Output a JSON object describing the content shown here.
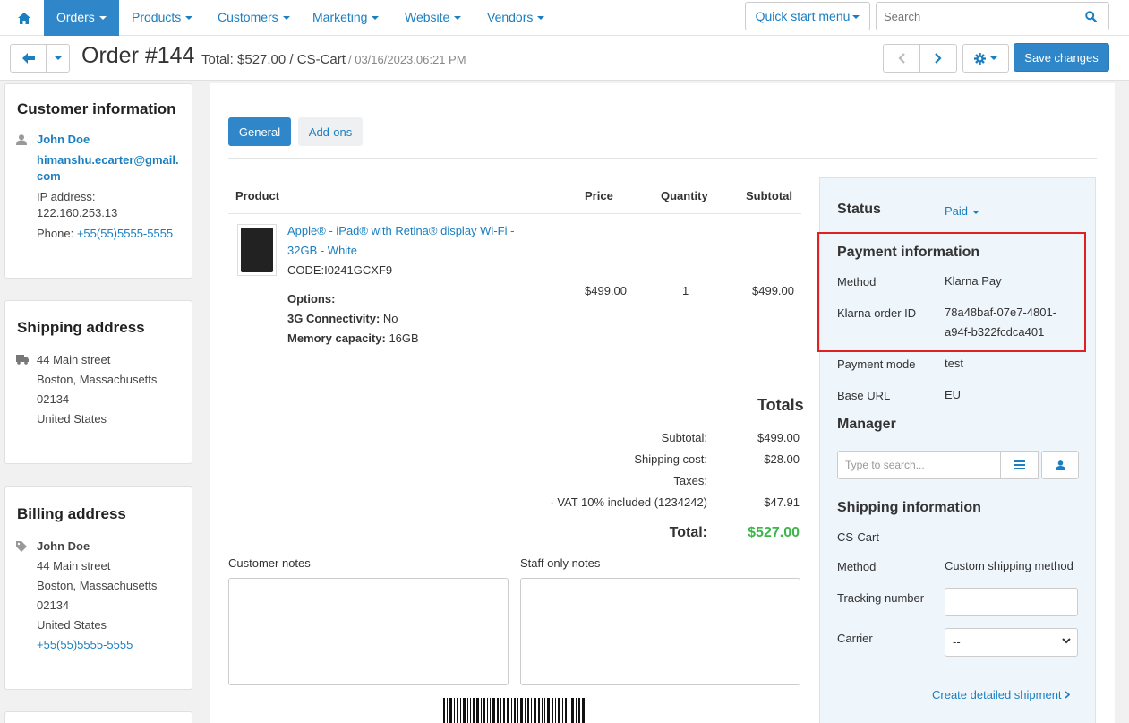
{
  "nav": {
    "items": [
      {
        "label": "Orders",
        "active": true
      },
      {
        "label": "Products"
      },
      {
        "label": "Customers"
      },
      {
        "label": "Marketing"
      },
      {
        "label": "Website"
      },
      {
        "label": "Vendors"
      }
    ],
    "quick_start_label": "Quick start menu",
    "search_placeholder": "Search"
  },
  "header": {
    "title": "Order #144",
    "total": "Total: $527.00 / CS-Cart",
    "date": "/ 03/16/2023,06:21 PM",
    "save_label": "Save changes"
  },
  "customer": {
    "heading": "Customer information",
    "name": "John Doe",
    "email_line1": "himanshu.ecarter@gmail.",
    "email_line2": "com",
    "ip_label": "IP address:",
    "ip": "122.160.253.13",
    "phone_label": "Phone:",
    "phone": "+55(55)5555-5555"
  },
  "shipping_address": {
    "heading": "Shipping address",
    "street": "44 Main street",
    "city": "Boston, Massachusetts",
    "zip": "02134",
    "country": "United States"
  },
  "billing_address": {
    "heading": "Billing address",
    "name": "John Doe",
    "street": "44 Main street",
    "city": "Boston, Massachusetts",
    "zip": "02134",
    "country": "United States",
    "phone": "+55(55)5555-5555"
  },
  "tabs": {
    "general": "General",
    "addons": "Add-ons"
  },
  "table": {
    "headers": {
      "product": "Product",
      "price": "Price",
      "quantity": "Quantity",
      "subtotal": "Subtotal"
    },
    "product": {
      "name_line1": "Apple® - iPad® with Retina® display Wi-Fi -",
      "name_line2": "32GB - White",
      "code": "CODE:I0241GCXF9",
      "options_label": "Options:",
      "opt1_label": "3G Connectivity:",
      "opt1_value": "No",
      "opt2_label": "Memory capacity:",
      "opt2_value": "16GB",
      "price": "$499.00",
      "quantity": "1",
      "subtotal": "$499.00"
    }
  },
  "totals": {
    "heading": "Totals",
    "subtotal_label": "Subtotal:",
    "subtotal": "$499.00",
    "shipping_label": "Shipping cost:",
    "shipping": "$28.00",
    "taxes_label": "Taxes:",
    "vat_label": "· VAT 10% included (1234242)",
    "vat": "$47.91",
    "total_label": "Total:",
    "total": "$527.00",
    "total_color": "#3db54a"
  },
  "notes": {
    "customer_label": "Customer notes",
    "staff_label": "Staff only notes"
  },
  "status": {
    "label": "Status",
    "value": "Paid"
  },
  "payment": {
    "heading": "Payment information",
    "method_label": "Method",
    "method": "Klarna Pay",
    "klarna_label": "Klarna order ID",
    "klarna_id_line1": "78a48baf-07e7-4801-",
    "klarna_id_line2": "a94f-b322fcdca401",
    "mode_label": "Payment mode",
    "mode": "test",
    "base_url_label": "Base URL",
    "base_url": "EU"
  },
  "manager": {
    "heading": "Manager",
    "search_placeholder": "Type to search..."
  },
  "shipping_info": {
    "heading": "Shipping information",
    "store": "CS-Cart",
    "method_label": "Method",
    "method": "Custom shipping method",
    "tracking_label": "Tracking number",
    "carrier_label": "Carrier",
    "carrier_value": "--",
    "create_shipment": "Create detailed shipment"
  },
  "colors": {
    "accent": "#2f87c9",
    "link": "#1a7fc1",
    "highlight_box": "#e02121"
  }
}
